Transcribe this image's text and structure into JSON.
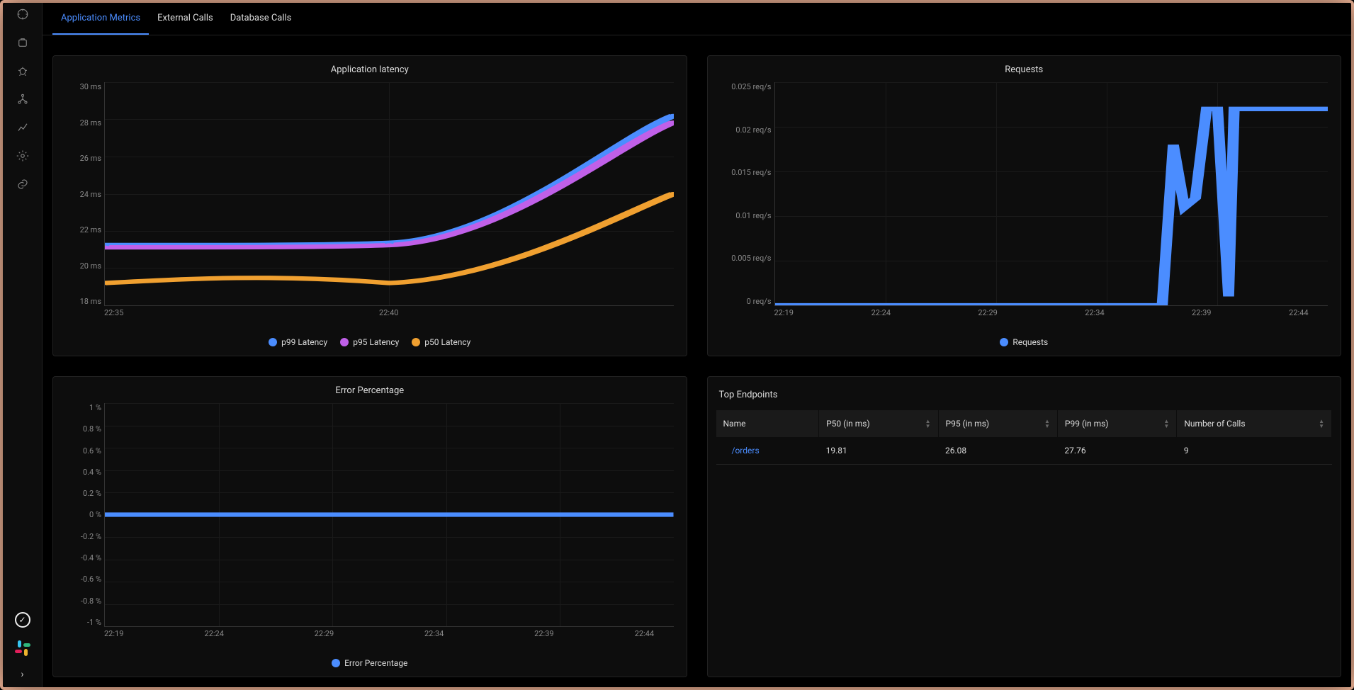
{
  "sidebar": {
    "icons": [
      "dashboard-icon",
      "alerts-icon",
      "bug-icon",
      "flow-icon",
      "metrics-icon",
      "settings-icon",
      "link-icon"
    ],
    "bottom": [
      "check-icon",
      "slack-icon",
      "expand-icon"
    ]
  },
  "tabs": [
    {
      "label": "Application Metrics",
      "active": true
    },
    {
      "label": "External Calls",
      "active": false
    },
    {
      "label": "Database Calls",
      "active": false
    }
  ],
  "chart_data": [
    {
      "type": "line",
      "title": "Application latency",
      "ylabel": "",
      "ylim": [
        18,
        30
      ],
      "yticks": [
        "30 ms",
        "28 ms",
        "26 ms",
        "24 ms",
        "22 ms",
        "20 ms",
        "18 ms"
      ],
      "categories": [
        "22:35",
        "22:40"
      ],
      "x": [
        0,
        1,
        2
      ],
      "series": [
        {
          "name": "p99 Latency",
          "color": "#4b8dff",
          "values": [
            21.2,
            21.3,
            28.2
          ]
        },
        {
          "name": "p95 Latency",
          "color": "#c060e8",
          "values": [
            21.1,
            21.2,
            27.8
          ]
        },
        {
          "name": "p50 Latency",
          "color": "#f0a030",
          "values": [
            19.2,
            19.0,
            24.0
          ]
        }
      ]
    },
    {
      "type": "line",
      "title": "Requests",
      "ylim": [
        0,
        0.025
      ],
      "yticks": [
        "0.025 req/s",
        "0.02 req/s",
        "0.015 req/s",
        "0.01 req/s",
        "0.005 req/s",
        "0 req/s"
      ],
      "categories": [
        "22:19",
        "22:24",
        "22:29",
        "22:34",
        "22:39",
        "22:44"
      ],
      "x": [
        0,
        1,
        2,
        3,
        3.5,
        3.6,
        3.7,
        3.8,
        3.9,
        4,
        4.1,
        4.15,
        4.2,
        4.6,
        5
      ],
      "series": [
        {
          "name": "Requests",
          "color": "#4b8dff",
          "values": [
            0,
            0,
            0,
            0,
            0,
            0.018,
            0.011,
            0.012,
            0.022,
            0.022,
            0.001,
            0.022,
            0.022,
            0.022,
            0.022
          ]
        }
      ]
    },
    {
      "type": "line",
      "title": "Error Percentage",
      "ylim": [
        -1,
        1
      ],
      "yticks": [
        "1 %",
        "0.8 %",
        "0.6 %",
        "0.4 %",
        "0.2 %",
        "0 %",
        "-0.2 %",
        "-0.4 %",
        "-0.6 %",
        "-0.8 %",
        "-1 %"
      ],
      "categories": [
        "22:19",
        "22:24",
        "22:29",
        "22:34",
        "22:39",
        "22:44"
      ],
      "x": [
        0,
        5
      ],
      "series": [
        {
          "name": "Error Percentage",
          "color": "#4b8dff",
          "values": [
            0,
            0
          ]
        }
      ]
    }
  ],
  "endpoints": {
    "title": "Top Endpoints",
    "columns": [
      "Name",
      "P50 (in ms)",
      "P95 (in ms)",
      "P99 (in ms)",
      "Number of Calls"
    ],
    "rows": [
      {
        "name": "/orders",
        "p50": "19.81",
        "p95": "26.08",
        "p99": "27.76",
        "calls": "9"
      }
    ]
  },
  "colors": {
    "blue": "#4b8dff",
    "purple": "#c060e8",
    "orange": "#f0a030"
  }
}
